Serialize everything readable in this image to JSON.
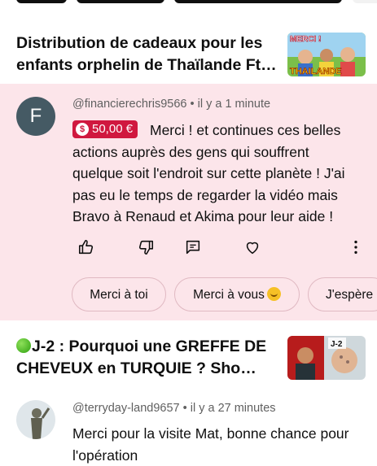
{
  "video1": {
    "title": "Distribution de cadeaux pour les enfants orphelin de Thaïlande Ft…",
    "thumb_top_label": "MERCI !",
    "thumb_bottom_label": "THAILANDE"
  },
  "comment1": {
    "avatar_letter": "F",
    "meta": "@financierechris9566 • il y a 1 minute",
    "amount": "50,00 €",
    "text": "Merci ! et continues ces belles actions auprès des gens qui souffrent quelque soit l'endroit sur cette planète ! J'ai pas eu le temps de regarder la vidéo mais Bravo à Renaud et Akima pour leur aide !",
    "actions": [
      "like-icon",
      "dislike-icon",
      "reply-icon",
      "heart-icon",
      "more-vert-icon"
    ]
  },
  "reply_suggestions": [
    "Merci à toi",
    "Merci à vous",
    "J'espère"
  ],
  "video2": {
    "title": "J-2 : Pourquoi une GREFFE DE CHEVEUX en TURQUIE ? Sho…",
    "thumb_label": "J-2"
  },
  "comment2": {
    "meta": "@terryday-land9657 • il y a 27 minutes",
    "text": "Merci pour la visite Mat, bonne chance pour l'opération"
  },
  "colors": {
    "card_bg": "#fce5ea",
    "badge_bg": "#d0183f"
  }
}
